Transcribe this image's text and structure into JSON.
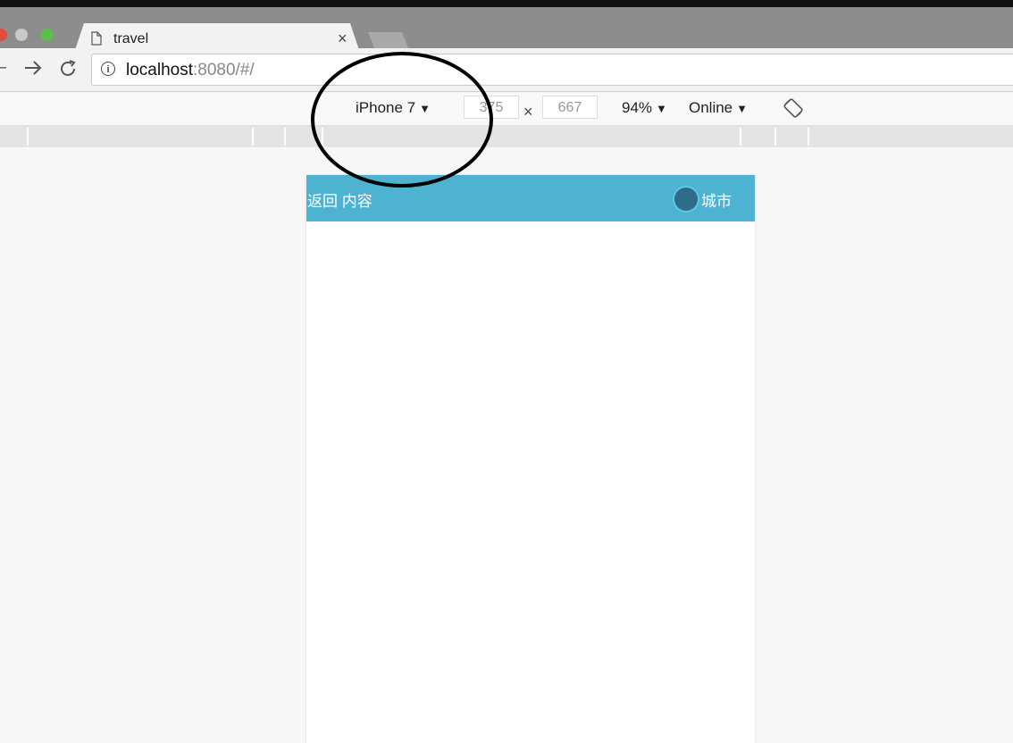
{
  "browser": {
    "tab_title": "travel",
    "tab_close": "×",
    "url_host": "localhost",
    "url_rest": ":8080/#/"
  },
  "device_toolbar": {
    "device_label": "iPhone 7",
    "width_value": "375",
    "times_symbol": "×",
    "height_value": "667",
    "zoom_label": "94%",
    "network_label": "Online",
    "dropdown_arrow": "▼"
  },
  "app": {
    "header_left_text": "返回 内容",
    "header_right_text": "城市",
    "header_color": "#4db3d1"
  },
  "icons": [
    "page-icon",
    "back-arrow-icon",
    "forward-arrow-icon",
    "reload-icon",
    "info-icon",
    "rotate-icon"
  ]
}
